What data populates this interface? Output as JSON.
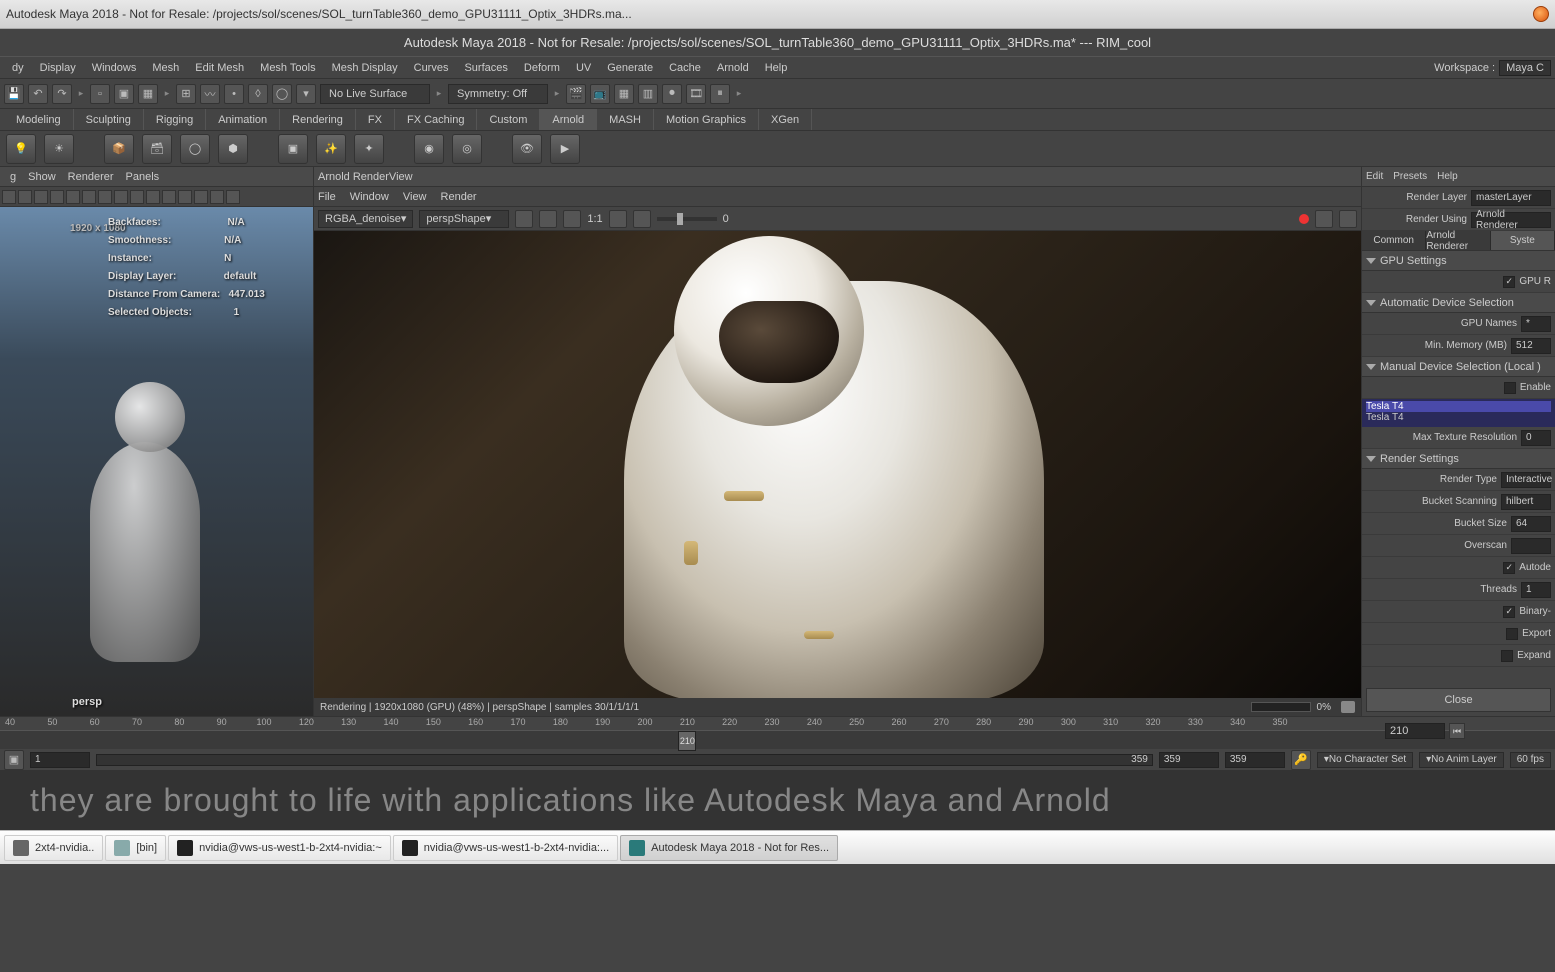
{
  "os_window": {
    "title": "Autodesk Maya 2018 - Not for Resale: /projects/sol/scenes/SOL_turnTable360_demo_GPU31111_Optix_3HDRs.ma..."
  },
  "app_window": {
    "title": "Autodesk Maya 2018 - Not for Resale: /projects/sol/scenes/SOL_turnTable360_demo_GPU31111_Optix_3HDRs.ma*  ---   RIM_cool"
  },
  "main_menu": [
    "dy",
    "Display",
    "Windows",
    "Mesh",
    "Edit Mesh",
    "Mesh Tools",
    "Mesh Display",
    "Curves",
    "Surfaces",
    "Deform",
    "UV",
    "Generate",
    "Cache",
    "Arnold",
    "Help"
  ],
  "workspace": {
    "label": "Workspace :",
    "value": "Maya C"
  },
  "toolbar1": {
    "live_surface": "No Live Surface",
    "symmetry": "Symmetry: Off"
  },
  "shelf_tabs": [
    "Modeling",
    "Sculpting",
    "Rigging",
    "Animation",
    "Rendering",
    "FX",
    "FX Caching",
    "Custom",
    "Arnold",
    "MASH",
    "Motion Graphics",
    "XGen"
  ],
  "shelf_active": "Arnold",
  "viewport": {
    "menu": [
      "g",
      "Show",
      "Renderer",
      "Panels"
    ],
    "hud": {
      "resolution": "1920 x 1080",
      "rows": [
        {
          "k": "Backfaces:",
          "v": "N/A"
        },
        {
          "k": "Smoothness:",
          "v": "N/A"
        },
        {
          "k": "Instance:",
          "v": "N"
        },
        {
          "k": "Display Layer:",
          "v": "default"
        },
        {
          "k": "Distance From Camera:",
          "v": "447.013"
        },
        {
          "k": "Selected Objects:",
          "v": "1"
        }
      ],
      "camera": "persp"
    }
  },
  "renderview": {
    "title": "Arnold RenderView",
    "menu": [
      "File",
      "Window",
      "View",
      "Render"
    ],
    "channel": "RGBA_denoise",
    "camera": "perspShape",
    "ratio": "1:1",
    "exposure": "0",
    "status": "Rendering | 1920x1080 (GPU) (48%) | perspShape  | samples 30/1/1/1/1",
    "progress": "0%"
  },
  "settings_panel": {
    "menu": [
      "Edit",
      "Presets",
      "Help"
    ],
    "render_layer": {
      "label": "Render Layer",
      "value": "masterLayer"
    },
    "render_using": {
      "label": "Render Using",
      "value": "Arnold Renderer"
    },
    "tabs": [
      "Common",
      "Arnold Renderer",
      "Syste"
    ],
    "gpu_section": "GPU Settings",
    "gpu_r": {
      "label": "GPU R",
      "checked": true
    },
    "auto_device": "Automatic Device Selection",
    "gpu_names": {
      "label": "GPU Names",
      "value": "*"
    },
    "min_memory": {
      "label": "Min. Memory (MB)",
      "value": "512"
    },
    "manual_device": "Manual Device Selection (Local )",
    "enable": {
      "label": "Enable",
      "checked": false
    },
    "devices": [
      "Tesla T4",
      "Tesla T4"
    ],
    "max_tex": {
      "label": "Max Texture Resolution",
      "value": "0"
    },
    "render_settings": "Render Settings",
    "render_type": {
      "label": "Render Type",
      "value": "Interactive"
    },
    "bucket_scanning": {
      "label": "Bucket Scanning",
      "value": "hilbert"
    },
    "bucket_size": {
      "label": "Bucket Size",
      "value": "64"
    },
    "overscan": {
      "label": "Overscan",
      "value": ""
    },
    "autode": {
      "label": "Autode",
      "checked": true
    },
    "threads": {
      "label": "Threads",
      "value": "1"
    },
    "binary": {
      "label": "Binary-",
      "checked": true
    },
    "export": {
      "label": "Export",
      "checked": false
    },
    "expand": {
      "label": "Expand",
      "checked": false
    },
    "close": "Close"
  },
  "timeline": {
    "ticks": [
      "40",
      "50",
      "60",
      "70",
      "80",
      "90",
      "100",
      "120",
      "130",
      "140",
      "150",
      "160",
      "170",
      "180",
      "190",
      "200",
      "210",
      "220",
      "230",
      "240",
      "250",
      "260",
      "270",
      "280",
      "290",
      "300",
      "310",
      "320",
      "330",
      "340",
      "350"
    ],
    "current_frame": "210",
    "current_field": "210"
  },
  "range_bar": {
    "start": "1",
    "first_end": "359",
    "second": "359",
    "third": "359",
    "char_set": "No Character Set",
    "anim_layer": "No Anim Layer",
    "fps": "60 fps"
  },
  "info_text": "they are brought to life with applications like Autodesk Maya and Arnold",
  "taskbar": {
    "items": [
      {
        "label": "2xt4-nvidia..",
        "icon": "terminal"
      },
      {
        "label": "[bin]",
        "icon": "folder"
      },
      {
        "label": "nvidia@vws-us-west1-b-2xt4-nvidia:~",
        "icon": "terminal"
      },
      {
        "label": "nvidia@vws-us-west1-b-2xt4-nvidia:...",
        "icon": "terminal"
      },
      {
        "label": "Autodesk Maya 2018 - Not for Res...",
        "icon": "maya",
        "active": true
      }
    ]
  }
}
